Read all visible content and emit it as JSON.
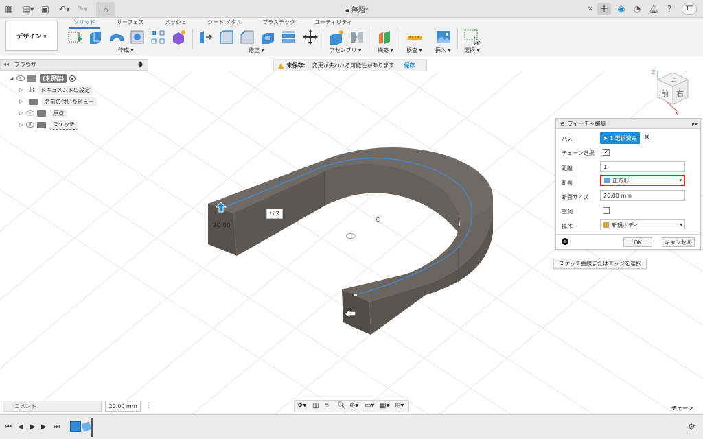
{
  "window": {
    "title": "無題*"
  },
  "user": {
    "initials": "TT"
  },
  "toolbar": {
    "design_label": "デザイン ▾",
    "tabs": [
      "ソリッド",
      "サーフェス",
      "メッシュ",
      "シート メタル",
      "プラスチック",
      "ユーティリティ"
    ],
    "groups": [
      "作成 ▾",
      "修正 ▾",
      "アセンブリ ▾",
      "構築 ▾",
      "検査 ▾",
      "挿入 ▾",
      "選択 ▾"
    ]
  },
  "browser": {
    "title": "ブラウザ",
    "root": "(未保存)",
    "items": [
      "ドキュメントの設定",
      "名前の付いたビュー",
      "原点",
      "スケッチ"
    ]
  },
  "banner": {
    "warning_title": "未保存:",
    "message": "変更が失われる可能性があります",
    "save_label": "保存"
  },
  "viewcube": {
    "top": "上",
    "front": "前",
    "right": "右",
    "axis_z": "Z",
    "axis_x": "X"
  },
  "canvas": {
    "dimension_text": "20.00",
    "path_label": "パス"
  },
  "feature_panel": {
    "title": "フィーチャ編集",
    "rows": {
      "path_label": "パス",
      "path_value": "1 選択済み",
      "chain_label": "チェーン選択",
      "distance_label": "距離",
      "distance_value": "1",
      "section_label": "断面",
      "section_value": "正方形",
      "section_size_label": "断面サイズ",
      "section_size_value": "20.00 mm",
      "hollow_label": "空洞",
      "operation_label": "操作",
      "operation_value": "新規ボディ"
    },
    "ok_label": "OK",
    "cancel_label": "キャンセル"
  },
  "tooltip": {
    "text": "スケッチ曲線またはエッジを選択"
  },
  "bottom": {
    "comment_label": "コメント",
    "dimension_value": "20.00 mm",
    "mode_label": "チェーン"
  },
  "colors": {
    "accent": "#1f8dd6",
    "body": "#625c56",
    "path": "#3f8ad6",
    "highlight_border": "#d1302c"
  }
}
